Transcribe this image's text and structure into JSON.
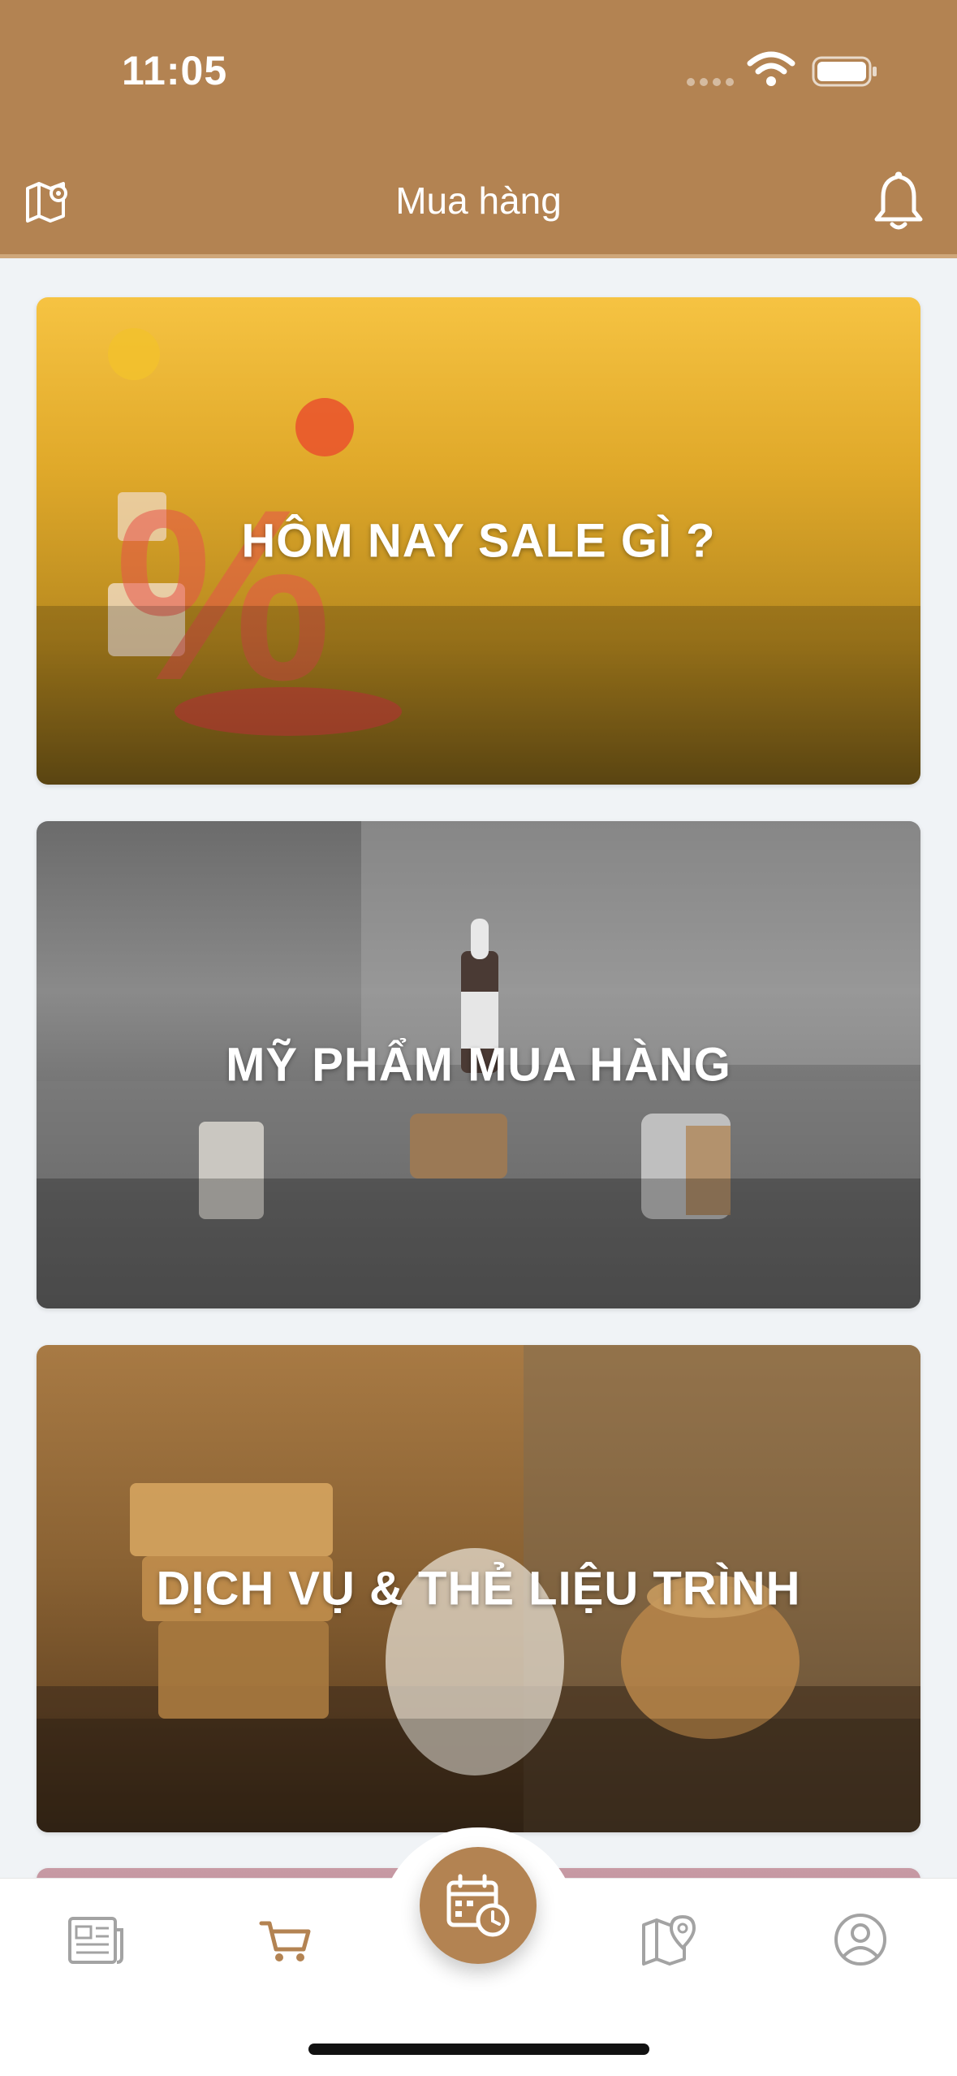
{
  "status_bar": {
    "time": "11:05"
  },
  "header": {
    "title": "Mua hàng",
    "left_icon": "map-pin-icon",
    "right_icon": "bell-icon"
  },
  "cards": [
    {
      "label": "HÔM NAY SALE GÌ ?"
    },
    {
      "label": "MỸ PHẨM MUA HÀNG"
    },
    {
      "label": "DỊCH VỤ & THẺ LIỆU TRÌNH"
    },
    {
      "label": ""
    }
  ],
  "tabbar": {
    "items": [
      {
        "icon": "newspaper-icon"
      },
      {
        "icon": "cart-icon",
        "active": true
      },
      {
        "icon": "calendar-clock-icon",
        "center": true
      },
      {
        "icon": "map-icon"
      },
      {
        "icon": "user-circle-icon"
      }
    ]
  },
  "colors": {
    "brand": "#b38352",
    "background": "#f0f3f6",
    "inactive_icon": "#9a9a9a"
  }
}
